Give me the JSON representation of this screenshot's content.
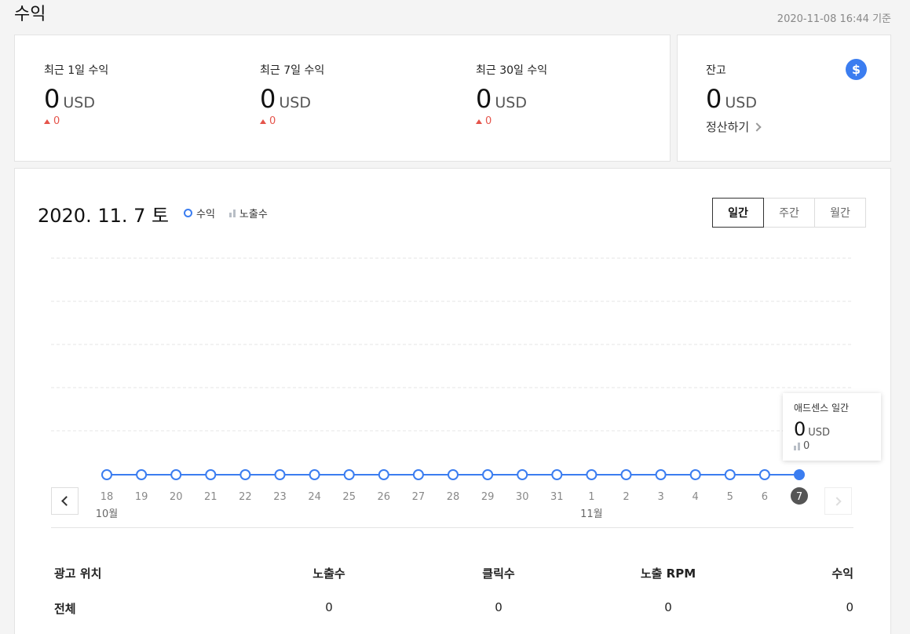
{
  "header": {
    "title": "수익",
    "timestamp": "2020-11-08 16:44 기준"
  },
  "summary": [
    {
      "label": "최근 1일 수익",
      "value": "0",
      "unit": "USD",
      "delta": "0"
    },
    {
      "label": "최근 7일 수익",
      "value": "0",
      "unit": "USD",
      "delta": "0"
    },
    {
      "label": "최근 30일 수익",
      "value": "0",
      "unit": "USD",
      "delta": "0"
    }
  ],
  "balance": {
    "label": "잔고",
    "value": "0",
    "unit": "USD",
    "action": "정산하기",
    "icon": "dollar-icon"
  },
  "chart_header": {
    "date": "2020. 11. 7 토",
    "legend_revenue": "수익",
    "legend_impressions": "노출수"
  },
  "period_tabs": [
    "일간",
    "주간",
    "월간"
  ],
  "active_period": "일간",
  "tooltip": {
    "label": "애드센스 일간",
    "value": "0",
    "unit": "USD",
    "impressions": "0"
  },
  "colors": {
    "accent": "#3b7df0",
    "delta_up": "#e5544b",
    "selected_day_bg": "#555555"
  },
  "chart_data": {
    "type": "line",
    "x": [
      "18",
      "19",
      "20",
      "21",
      "22",
      "23",
      "24",
      "25",
      "26",
      "27",
      "28",
      "29",
      "30",
      "31",
      "1",
      "2",
      "3",
      "4",
      "5",
      "6",
      "7"
    ],
    "month_labels": [
      {
        "at": "18",
        "label": "10월"
      },
      {
        "at": "1",
        "label": "11월"
      }
    ],
    "series": [
      {
        "name": "수익",
        "values": [
          0,
          0,
          0,
          0,
          0,
          0,
          0,
          0,
          0,
          0,
          0,
          0,
          0,
          0,
          0,
          0,
          0,
          0,
          0,
          0,
          0
        ]
      }
    ],
    "selected": "7",
    "grid": true
  },
  "table": {
    "headers": [
      "광고 위치",
      "노출수",
      "클릭수",
      "노출 RPM",
      "수익"
    ],
    "rows": [
      [
        "전체",
        "0",
        "0",
        "0",
        "0"
      ]
    ]
  }
}
